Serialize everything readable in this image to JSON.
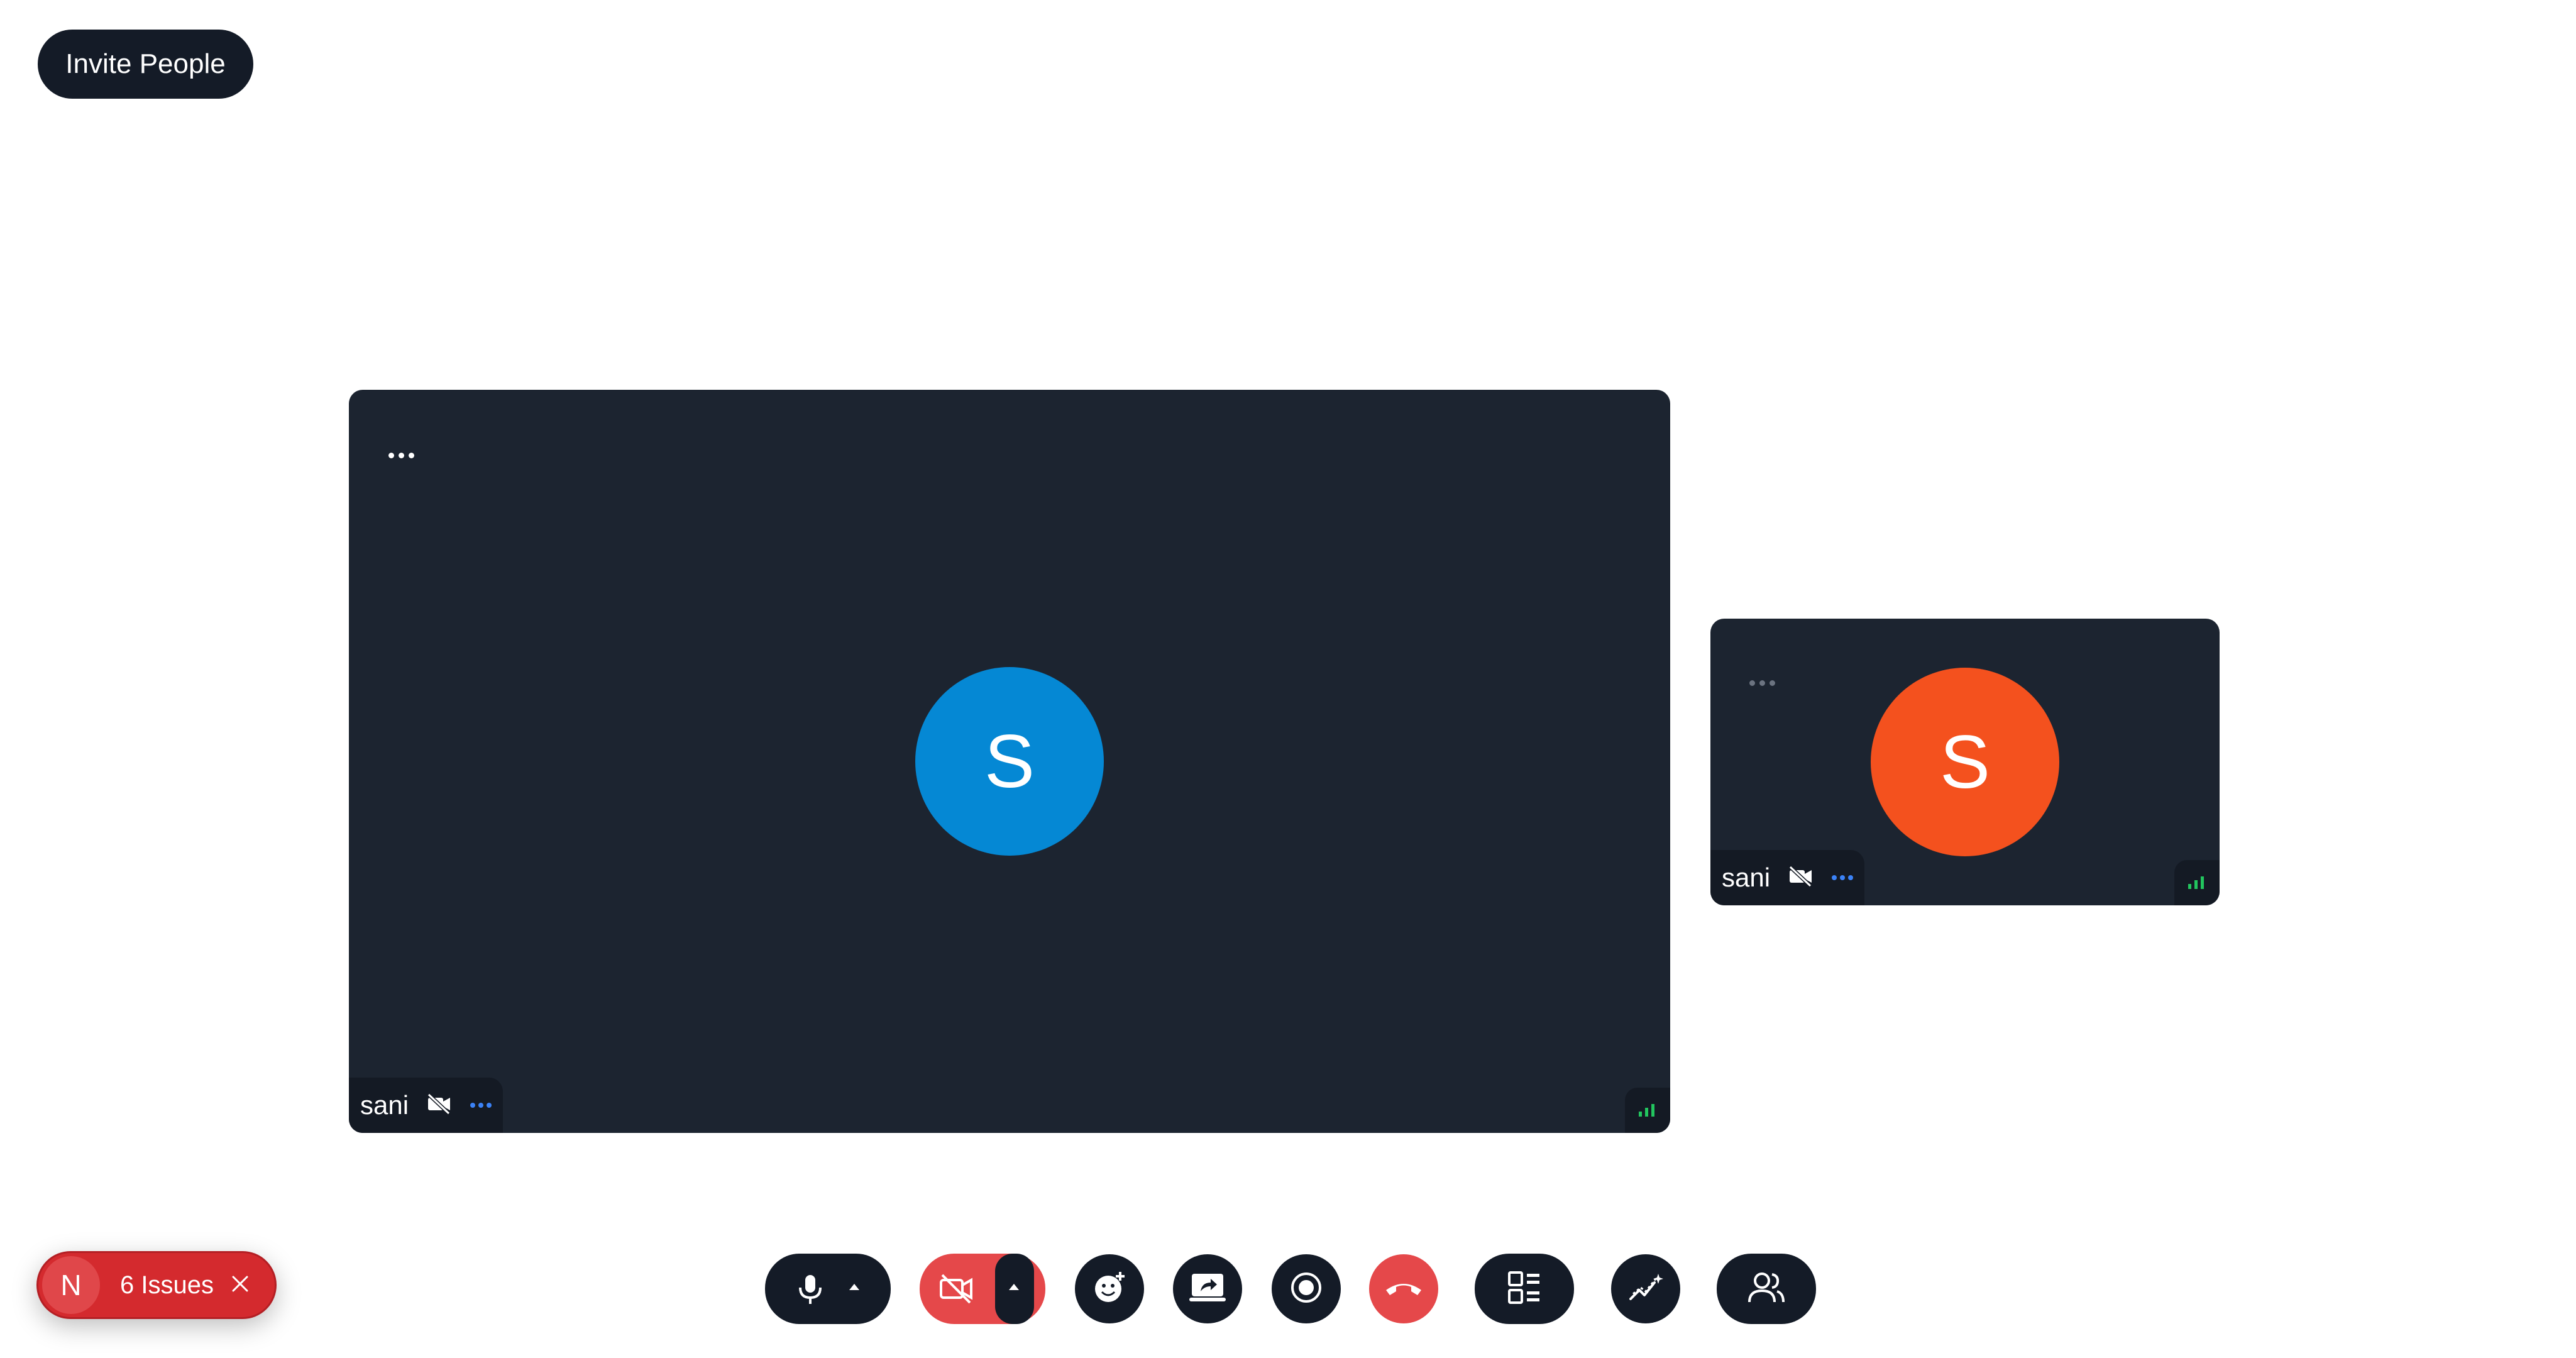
{
  "header": {
    "invite_label": "Invite People"
  },
  "tiles": [
    {
      "initial": "S",
      "name": "sani",
      "avatar_color": "#0588d4"
    },
    {
      "initial": "S",
      "name": "sani",
      "avatar_color": "#f4511e"
    }
  ],
  "issues": {
    "badge": "N",
    "label": "6 Issues"
  },
  "toolbar": {
    "icons": [
      "microphone-icon",
      "caret-up-icon",
      "camera-off-icon",
      "caret-up-icon",
      "emoji-add-icon",
      "screen-share-icon",
      "record-icon",
      "end-call-icon",
      "layout-icon",
      "whiteboard-icon",
      "participants-icon"
    ]
  },
  "colors": {
    "tile_bg": "#1c2430",
    "button_dark": "#141b27",
    "danger": "#e5484a",
    "signal": "#22c55e"
  }
}
